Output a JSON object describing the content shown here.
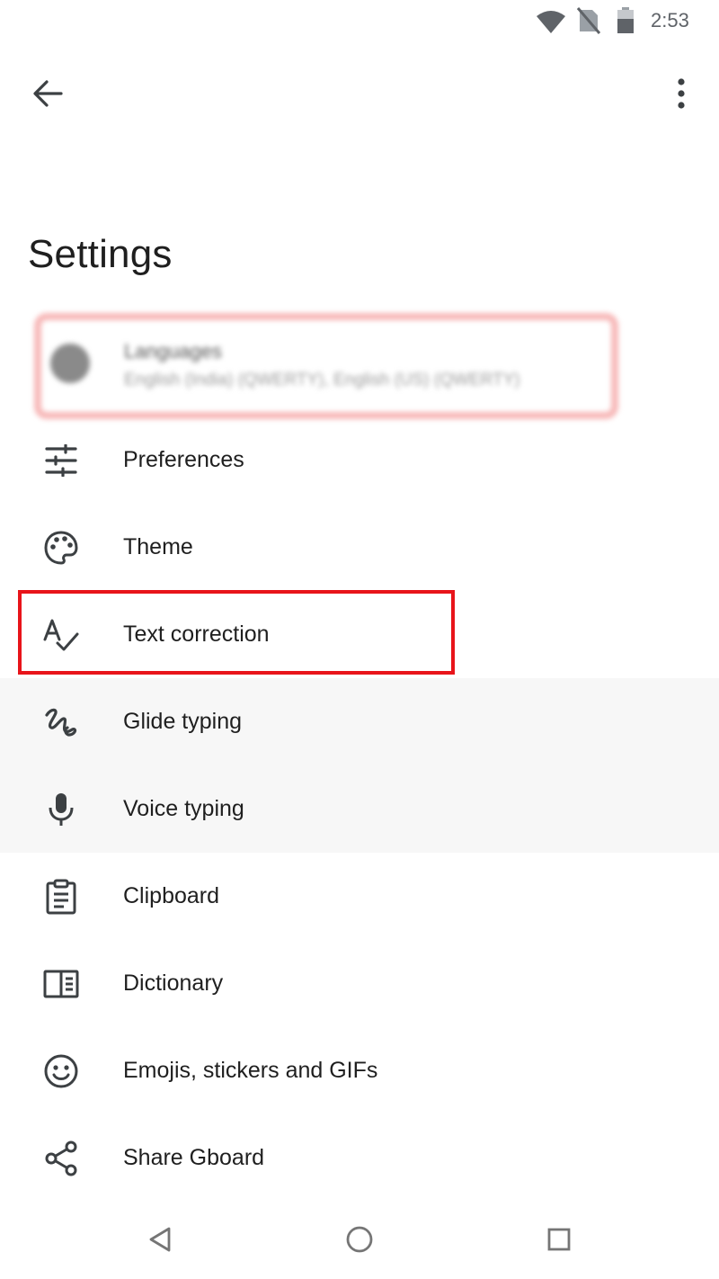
{
  "status_bar": {
    "time": "2:53",
    "icons": [
      "wifi-icon",
      "no-sim-icon",
      "battery-icon"
    ]
  },
  "top_bar": {
    "back_icon": "arrow-back-icon",
    "more_icon": "more-vert-icon"
  },
  "page": {
    "title": "Settings"
  },
  "languages": {
    "label": "Languages",
    "subtitle": "English (India) (QWERTY), English (US) (QWERTY)",
    "obscured": true
  },
  "menu": [
    {
      "id": "preferences",
      "label": "Preferences",
      "icon": "tune-icon"
    },
    {
      "id": "theme",
      "label": "Theme",
      "icon": "palette-icon"
    },
    {
      "id": "text-correction",
      "label": "Text correction",
      "icon": "spellcheck-icon",
      "highlighted": true
    },
    {
      "id": "glide-typing",
      "label": "Glide typing",
      "icon": "gesture-icon"
    },
    {
      "id": "voice-typing",
      "label": "Voice typing",
      "icon": "mic-icon"
    },
    {
      "id": "clipboard",
      "label": "Clipboard",
      "icon": "clipboard-icon"
    },
    {
      "id": "dictionary",
      "label": "Dictionary",
      "icon": "dictionary-icon"
    },
    {
      "id": "emojis",
      "label": "Emojis, stickers and GIFs",
      "icon": "emoji-icon"
    },
    {
      "id": "share-gboard",
      "label": "Share Gboard",
      "icon": "share-icon"
    }
  ],
  "nav_bar": {
    "back": "nav-back-icon",
    "home": "nav-home-icon",
    "recents": "nav-recents-icon"
  },
  "colors": {
    "highlight": "#e8141a",
    "icon": "#3c4043",
    "text": "#1f1f1f",
    "shaded_row": "#f7f7f7"
  }
}
